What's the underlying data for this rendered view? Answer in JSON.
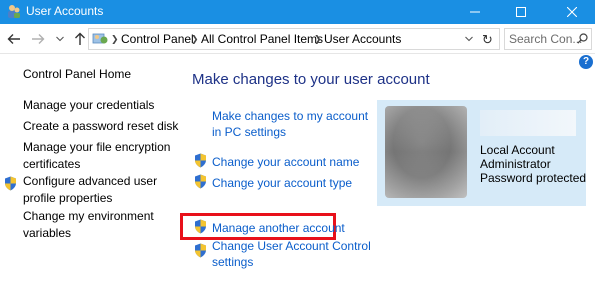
{
  "window": {
    "title": "User Accounts",
    "controls": [
      "minimize",
      "maximize",
      "close"
    ]
  },
  "address_bar": {
    "breadcrumbs": [
      "Control Panel",
      "All Control Panel Items",
      "User Accounts"
    ],
    "search_placeholder": "Search Con..."
  },
  "help": {
    "label": "?"
  },
  "left_nav": {
    "home": "Control Panel Home",
    "items": [
      {
        "label_lines": [
          "Manage your credentials"
        ],
        "shield": false
      },
      {
        "label_lines": [
          "Create a password reset disk"
        ],
        "shield": false
      },
      {
        "label_lines": [
          "Manage your file encryption",
          "certificates"
        ],
        "shield": false
      },
      {
        "label_lines": [
          "Configure advanced user",
          "profile properties"
        ],
        "shield": true
      },
      {
        "label_lines": [
          "Change my environment",
          "variables"
        ],
        "shield": false
      }
    ]
  },
  "main": {
    "title": "Make changes to your user account",
    "links": [
      {
        "label_lines": [
          "Make changes to my account",
          "in PC settings"
        ],
        "shield": false
      },
      {
        "label_lines": [
          "Change your account name"
        ],
        "shield": true
      },
      {
        "label_lines": [
          "Change your account type"
        ],
        "shield": true
      },
      {
        "label_lines": [
          "Manage another account"
        ],
        "shield": true,
        "highlighted": true
      },
      {
        "label_lines": [
          "Change User Account Control",
          "settings"
        ],
        "shield": true
      }
    ]
  },
  "account": {
    "type": "Local Account",
    "role": "Administrator",
    "status": "Password protected"
  },
  "colors": {
    "title_bar": "#1a8fe3",
    "link": "#0b5ecb",
    "heading": "#1e3287",
    "highlight": "#e8101a",
    "account_card": "#d6eaf8"
  },
  "icons": [
    "user-accounts-icon",
    "back-arrow-icon",
    "forward-arrow-icon",
    "up-arrow-icon",
    "control-panel-icon",
    "refresh-icon",
    "search-icon",
    "help-icon",
    "uac-shield-icon"
  ]
}
